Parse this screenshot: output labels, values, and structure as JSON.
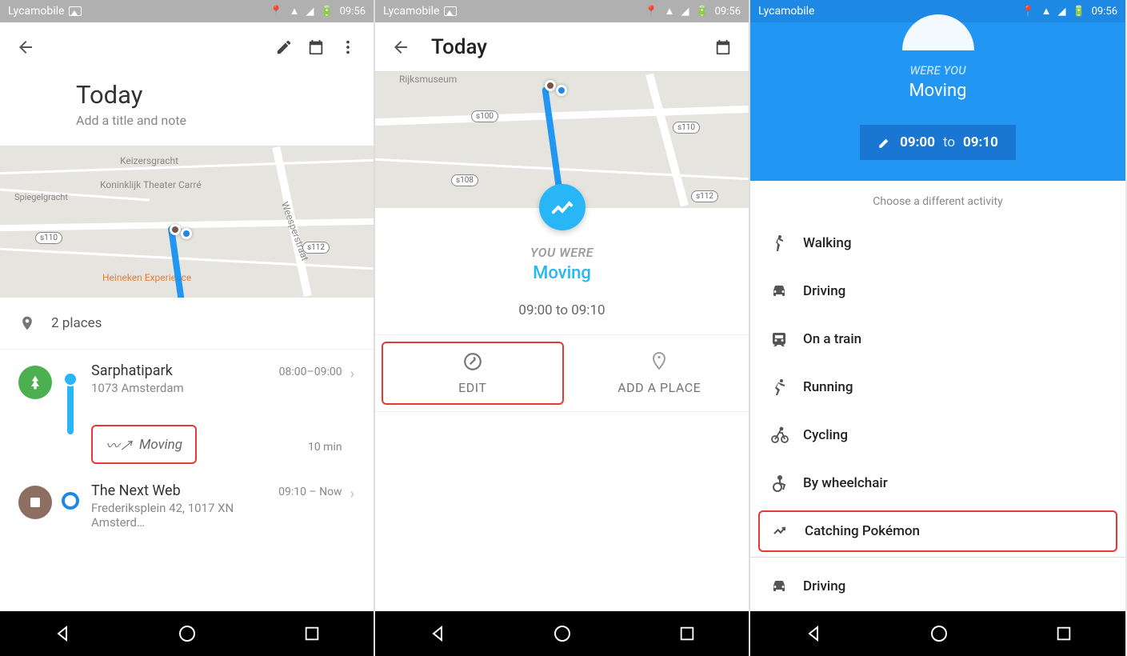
{
  "statusbar": {
    "carrier": "Lycamobile",
    "time": "09:56"
  },
  "screen1": {
    "title": "Today",
    "subtitle": "Add a title and note",
    "map": {
      "labels": [
        "Keizersgracht",
        "Koninklijk Theater Carré",
        "Spiegelgracht",
        "Heineken Experience",
        "Weesperstraat"
      ],
      "roads": [
        "s110",
        "s112"
      ]
    },
    "places_count": "2 places",
    "items": [
      {
        "name": "Sarphatipark",
        "sub": "1073 Amsterdam",
        "time": "08:00–09:00"
      },
      {
        "name": "The Next Web",
        "sub": "Frederiksplein 42, 1017 XN Amsterd…",
        "time": "09:10 – Now"
      }
    ],
    "moving": {
      "label": "Moving",
      "duration": "10 min"
    }
  },
  "screen2": {
    "title": "Today",
    "map": {
      "labels": [
        "Rijksmuseum"
      ],
      "roads": [
        "s100",
        "s108",
        "s110",
        "s112"
      ]
    },
    "you_were": "YOU WERE",
    "moving": "Moving",
    "time": "09:00 to 09:10",
    "edit": "EDIT",
    "add_place": "ADD A PLACE"
  },
  "screen3": {
    "were_you": "WERE YOU",
    "moving": "Moving",
    "time_from": "09:00",
    "time_to": "09:10",
    "to": "to",
    "choose": "Choose a different activity",
    "activities": [
      {
        "icon": "walk",
        "label": "Walking"
      },
      {
        "icon": "car",
        "label": "Driving"
      },
      {
        "icon": "train",
        "label": "On a train"
      },
      {
        "icon": "run",
        "label": "Running"
      },
      {
        "icon": "bike",
        "label": "Cycling"
      },
      {
        "icon": "wheelchair",
        "label": "By wheelchair"
      },
      {
        "icon": "trend",
        "label": "Catching Pokémon",
        "highlight": true
      }
    ],
    "secondary": [
      {
        "icon": "car",
        "label": "Driving"
      }
    ]
  }
}
